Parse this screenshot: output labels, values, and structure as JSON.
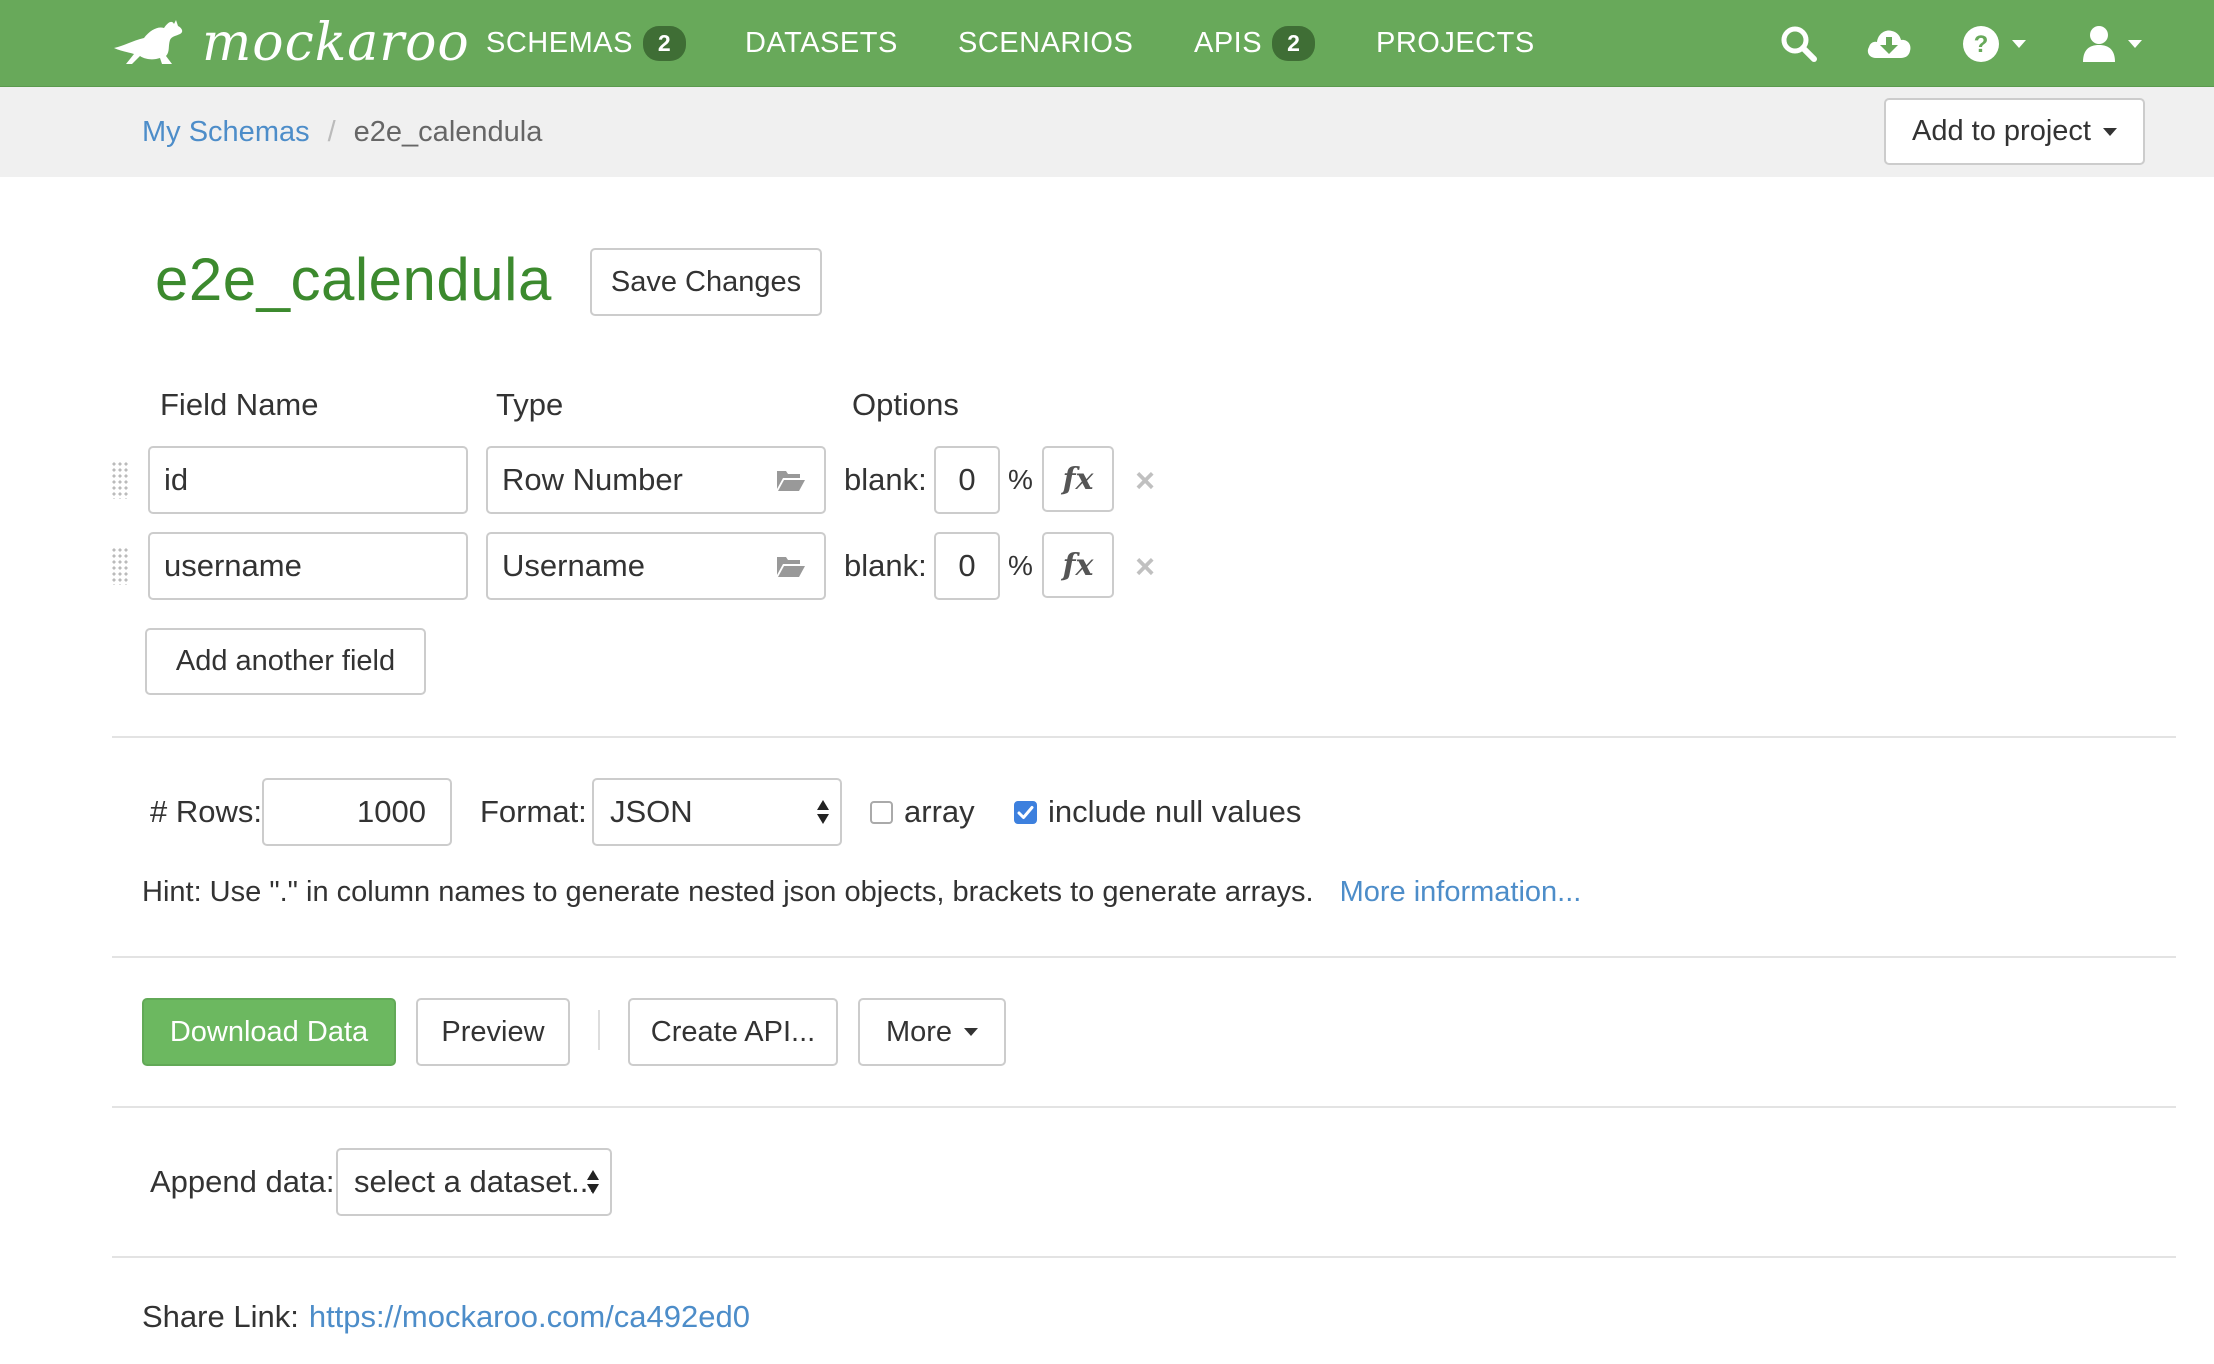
{
  "navbar": {
    "brand": "mockaroo",
    "items": [
      {
        "label": "SCHEMAS",
        "badge": "2"
      },
      {
        "label": "DATASETS"
      },
      {
        "label": "SCENARIOS"
      },
      {
        "label": "APIS",
        "badge": "2"
      },
      {
        "label": "PROJECTS"
      }
    ],
    "icons": [
      "search-icon",
      "cloud-download-icon",
      "help-icon",
      "user-icon"
    ],
    "color": "#68a95a"
  },
  "breadcrumb": {
    "parent": "My Schemas",
    "separator": "/",
    "current": "e2e_calendula"
  },
  "add_to_project_label": "Add to project",
  "schema": {
    "title": "e2e_calendula",
    "save_label": "Save Changes"
  },
  "columns": {
    "field_name": "Field Name",
    "type": "Type",
    "options": "Options"
  },
  "fields": [
    {
      "name": "id",
      "type": "Row Number",
      "blank_label": "blank:",
      "blank_value": "0",
      "percent": "%",
      "fx": "fx",
      "remove": "×"
    },
    {
      "name": "username",
      "type": "Username",
      "blank_label": "blank:",
      "blank_value": "0",
      "percent": "%",
      "fx": "fx",
      "remove": "×"
    }
  ],
  "add_field_label": "Add another field",
  "options": {
    "rows_label": "# Rows:",
    "rows_value": "1000",
    "format_label": "Format:",
    "format_value": "JSON",
    "array_label": "array",
    "array_checked": false,
    "include_null_label": "include null values",
    "include_null_checked": true
  },
  "hint": {
    "text": "Hint: Use \".\" in column names to generate nested json objects, brackets to generate arrays.",
    "link": "More information..."
  },
  "actions": {
    "download": "Download Data",
    "preview": "Preview",
    "create_api": "Create API...",
    "more": "More"
  },
  "append": {
    "label": "Append data:",
    "select": "select a dataset..."
  },
  "share": {
    "label": "Share Link:",
    "url": "https://mockaroo.com/ca492ed0"
  }
}
